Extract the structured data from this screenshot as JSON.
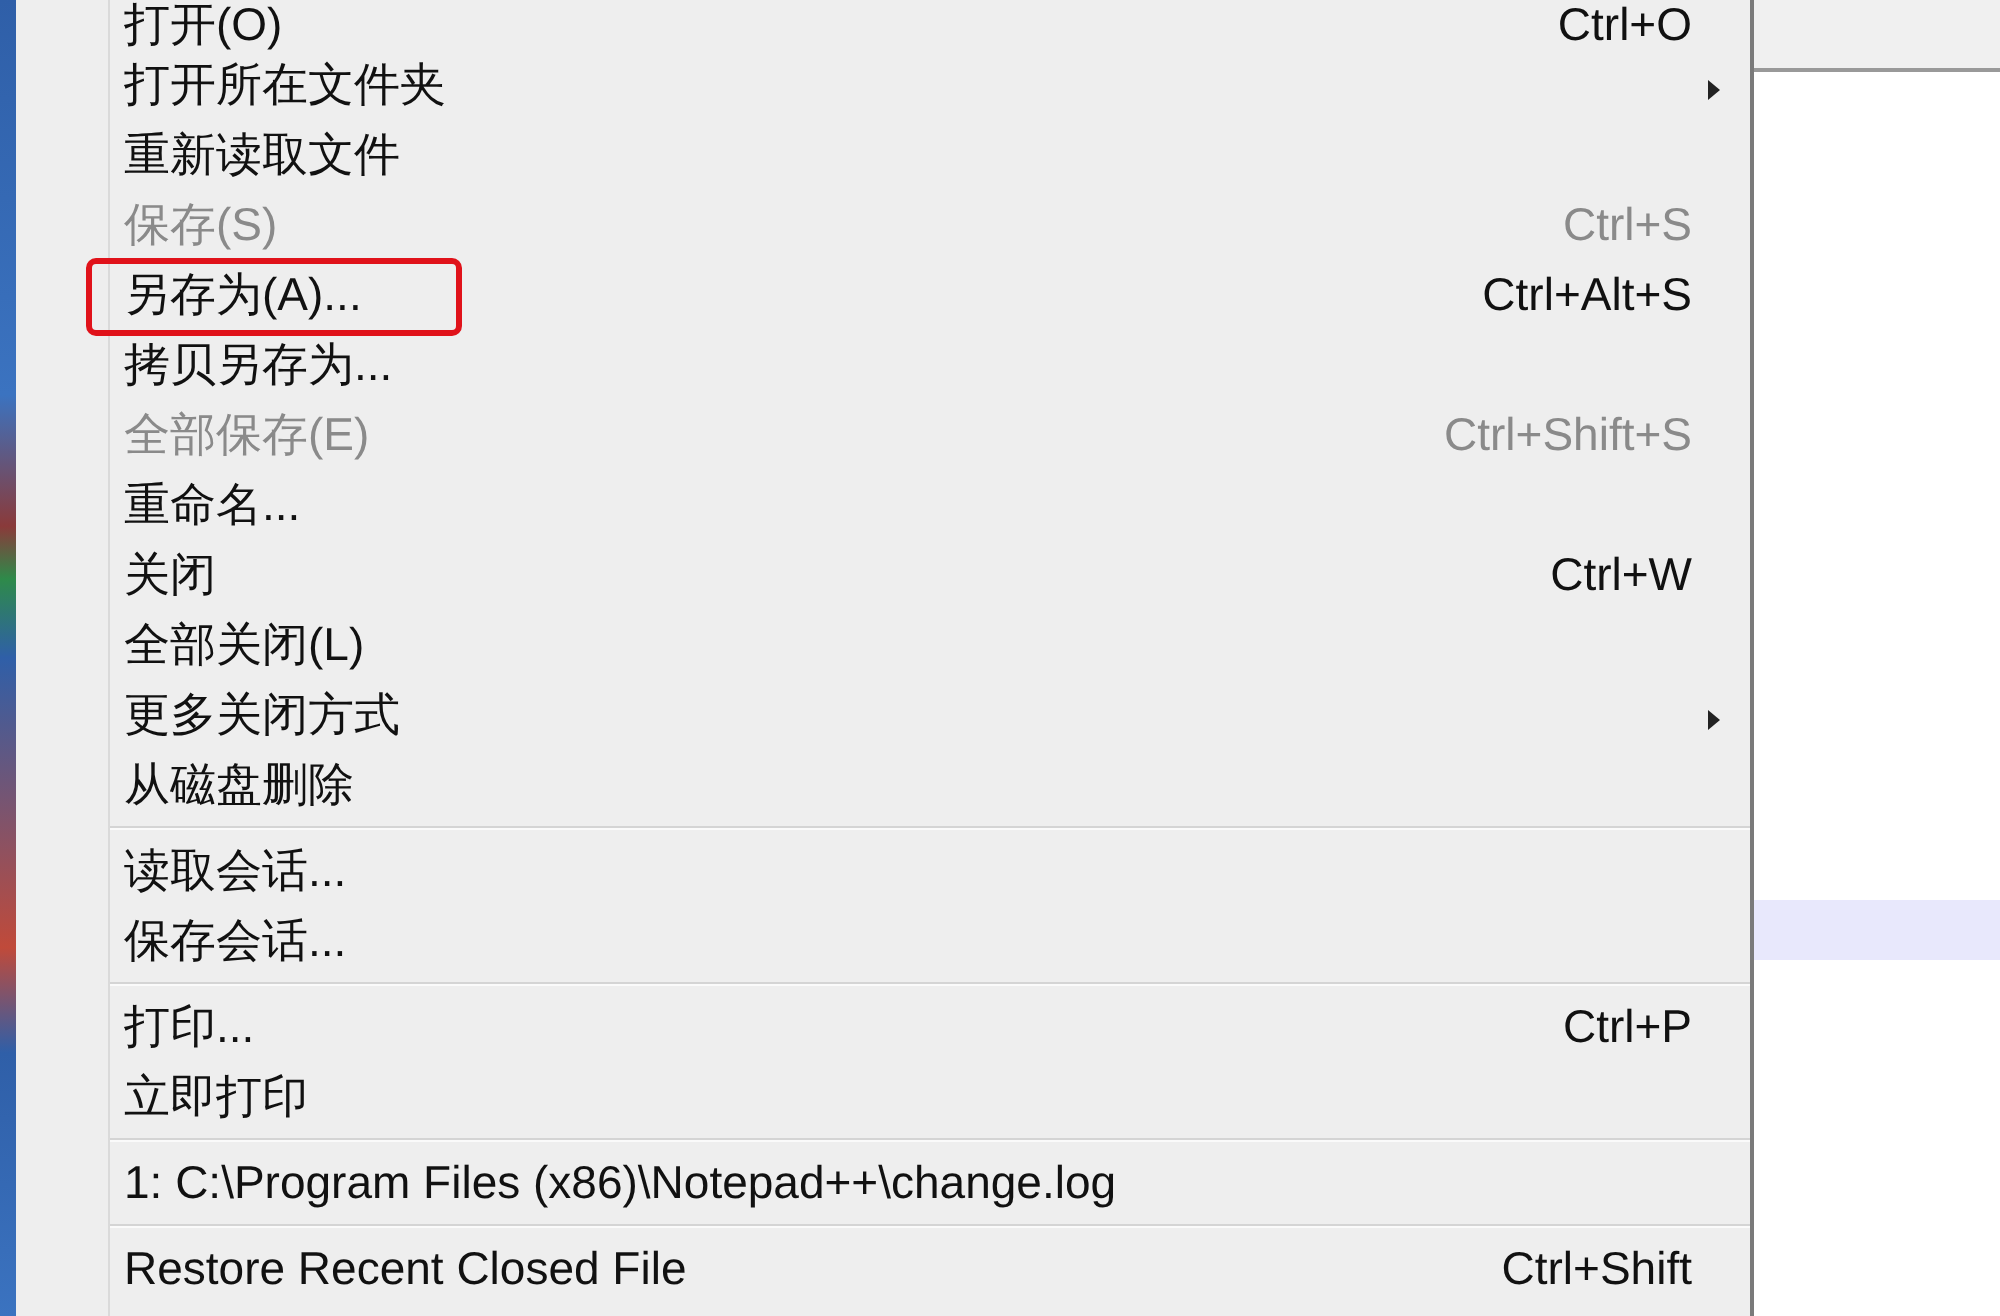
{
  "menu": {
    "items": [
      {
        "kind": "item",
        "label": "打开(O)",
        "shortcut": "Ctrl+O",
        "disabled": false,
        "submenu": false,
        "highlighted": false
      },
      {
        "kind": "item",
        "label": "打开所在文件夹",
        "disabled": false,
        "submenu": true,
        "highlighted": false
      },
      {
        "kind": "item",
        "label": "重新读取文件",
        "disabled": false,
        "submenu": false,
        "highlighted": false
      },
      {
        "kind": "item",
        "label": "保存(S)",
        "shortcut": "Ctrl+S",
        "disabled": true,
        "submenu": false,
        "highlighted": false
      },
      {
        "kind": "item",
        "label": "另存为(A)...",
        "shortcut": "Ctrl+Alt+S",
        "disabled": false,
        "submenu": false,
        "highlighted": true
      },
      {
        "kind": "item",
        "label": "拷贝另存为...",
        "disabled": false,
        "submenu": false,
        "highlighted": false
      },
      {
        "kind": "item",
        "label": "全部保存(E)",
        "shortcut": "Ctrl+Shift+S",
        "disabled": true,
        "submenu": false,
        "highlighted": false
      },
      {
        "kind": "item",
        "label": "重命名...",
        "disabled": false,
        "submenu": false,
        "highlighted": false
      },
      {
        "kind": "item",
        "label": "关闭",
        "shortcut": "Ctrl+W",
        "disabled": false,
        "submenu": false,
        "highlighted": false
      },
      {
        "kind": "item",
        "label": "全部关闭(L)",
        "disabled": false,
        "submenu": false,
        "highlighted": false
      },
      {
        "kind": "item",
        "label": "更多关闭方式",
        "disabled": false,
        "submenu": true,
        "highlighted": false
      },
      {
        "kind": "item",
        "label": "从磁盘删除",
        "disabled": false,
        "submenu": false,
        "highlighted": false
      },
      {
        "kind": "separator"
      },
      {
        "kind": "item",
        "label": "读取会话...",
        "disabled": false,
        "submenu": false,
        "highlighted": false
      },
      {
        "kind": "item",
        "label": "保存会话...",
        "disabled": false,
        "submenu": false,
        "highlighted": false
      },
      {
        "kind": "separator"
      },
      {
        "kind": "item",
        "label": "打印...",
        "shortcut": "Ctrl+P",
        "disabled": false,
        "submenu": false,
        "highlighted": false
      },
      {
        "kind": "item",
        "label": "立即打印",
        "disabled": false,
        "submenu": false,
        "highlighted": false
      },
      {
        "kind": "separator"
      },
      {
        "kind": "item",
        "label": "1: C:\\Program Files (x86)\\Notepad++\\change.log",
        "disabled": false,
        "submenu": false,
        "highlighted": false
      },
      {
        "kind": "separator"
      },
      {
        "kind": "item",
        "label": "Restore Recent Closed File",
        "shortcut": "Ctrl+Shift",
        "disabled": false,
        "submenu": false,
        "highlighted": false
      }
    ]
  }
}
